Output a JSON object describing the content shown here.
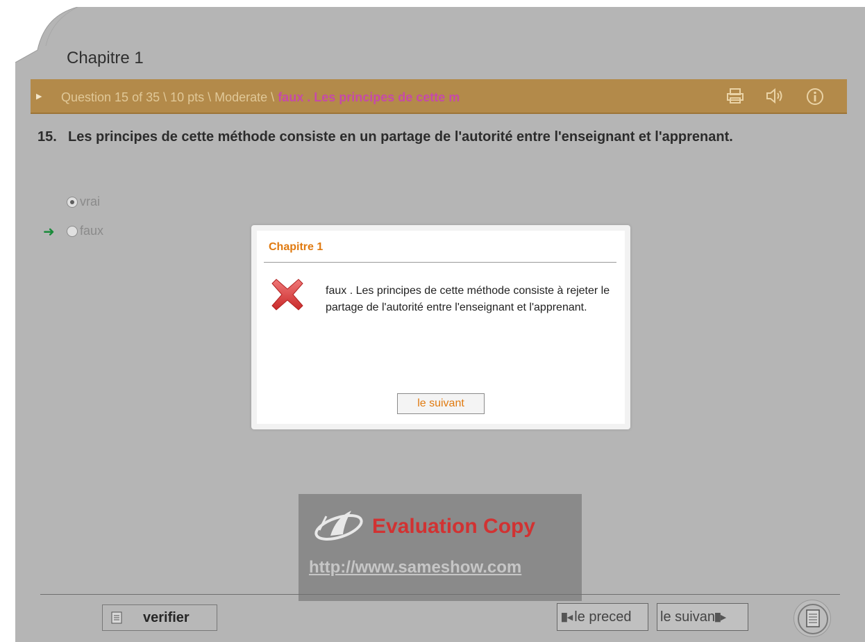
{
  "page": {
    "chapter_title": "Chapitre 1"
  },
  "question_bar": {
    "info": "Question 15 of 35 \\ 10 pts \\ Moderate \\ ",
    "answer_snippet": "faux . Les principes de cette m",
    "icons": [
      "print-icon",
      "sound-icon",
      "info-icon"
    ]
  },
  "question": {
    "number": "15.",
    "text": "Les principes de cette méthode consiste en un partage de l'autorité entre l'enseignant et l'apprenant.",
    "options": [
      {
        "label": "vrai",
        "selected": true,
        "correct": false
      },
      {
        "label": "faux",
        "selected": false,
        "correct": true
      }
    ]
  },
  "dialog": {
    "title": "Chapitre 1",
    "message": "faux . Les principes de cette méthode consiste à rejeter le partage de l'autorité entre l'enseignant et l'apprenant.",
    "button": "le suivant"
  },
  "watermark": {
    "text": "Evaluation Copy",
    "url": "http://www.sameshow.com"
  },
  "footer": {
    "verify_label": "verifier",
    "prev_label": "le preced",
    "next_label": "le suivan"
  },
  "colors": {
    "bar": "#b38a4a",
    "answer_snippet": "#c64aa8",
    "dialog_accent": "#e07a10",
    "correct_arrow": "#1a8b3a",
    "watermark_text": "#d13232"
  }
}
